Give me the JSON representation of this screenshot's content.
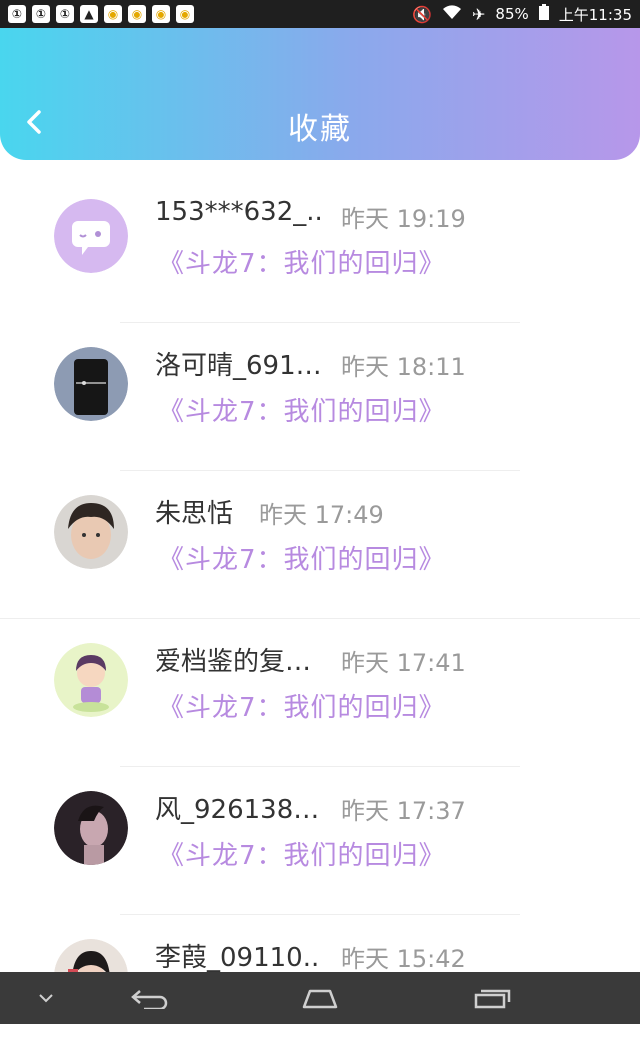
{
  "status_bar": {
    "battery": "85%",
    "time": "上午11:35",
    "left_icons": [
      "notification-icon",
      "notification-icon",
      "notification-icon",
      "image-icon",
      "wechat-icon",
      "wechat-icon",
      "wechat-icon",
      "wechat-icon"
    ]
  },
  "header": {
    "title": "收藏",
    "gradient": [
      "#49d6ee",
      "#b797ea"
    ]
  },
  "items": [
    {
      "name": "153***632_..",
      "time": "昨天 19:19",
      "book": "《斗龙7：我们的回归》"
    },
    {
      "name": "洛可晴_691…",
      "time": "昨天 18:11",
      "book": "《斗龙7：我们的回归》"
    },
    {
      "name": "朱思恬",
      "time": "昨天 17:49",
      "book": "《斗龙7：我们的回归》"
    },
    {
      "name": "爱档鉴的复…",
      "time": "昨天 17:41",
      "book": "《斗龙7：我们的回归》"
    },
    {
      "name": "风_926138…",
      "time": "昨天 17:37",
      "book": "《斗龙7：我们的回归》"
    },
    {
      "name": "李葭_09110..",
      "time": "昨天 15:42",
      "book": ""
    }
  ],
  "colors": {
    "book_title": "#b78ae0",
    "time": "#9a9a9a",
    "name": "#333333"
  }
}
